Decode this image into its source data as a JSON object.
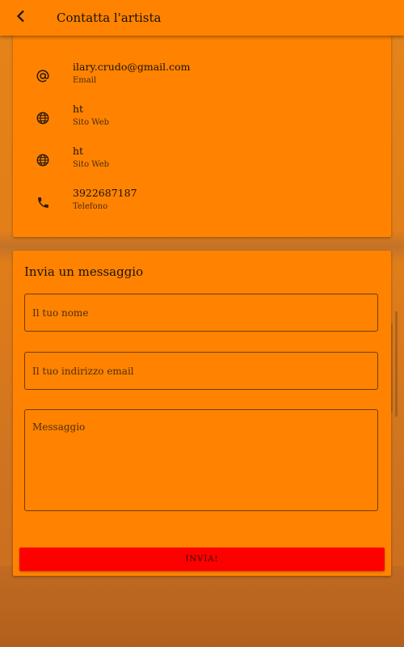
{
  "header": {
    "title": "Contatta l'artista",
    "back_icon": "chevron-left-icon"
  },
  "contacts": [
    {
      "icon": "at-icon",
      "value": "ilary.crudo@gmail.com",
      "label": "Email"
    },
    {
      "icon": "globe-icon",
      "value": "ht",
      "label": "Sito Web"
    },
    {
      "icon": "globe-icon",
      "value": "ht",
      "label": "Sito Web"
    },
    {
      "icon": "phone-icon",
      "value": "3922687187",
      "label": "Telefono"
    }
  ],
  "message_form": {
    "title": "Invia un messaggio",
    "name_placeholder": "Il tuo nome",
    "email_placeholder": "Il tuo indirizzo email",
    "message_placeholder": "Messaggio",
    "send_label": "INVIA!"
  },
  "colors": {
    "primary": "#ff8300",
    "send_button": "#ff0000"
  }
}
